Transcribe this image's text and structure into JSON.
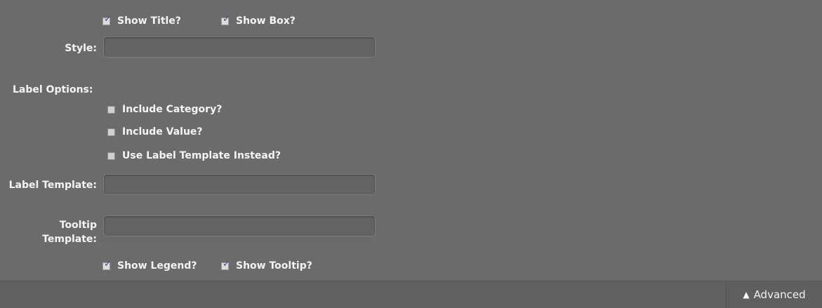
{
  "top_options": [
    {
      "label": "Show Title?",
      "checked": true
    },
    {
      "label": "Show Box?",
      "checked": true
    }
  ],
  "style": {
    "label": "Style:",
    "value": ""
  },
  "label_options": {
    "heading": "Label Options:",
    "items": [
      {
        "label": "Include Category?",
        "checked": false
      },
      {
        "label": "Include Value?",
        "checked": false
      },
      {
        "label": "Use Label Template Instead?",
        "checked": false
      }
    ]
  },
  "label_template": {
    "label": "Label Template:",
    "value": ""
  },
  "tooltip_template": {
    "label_line1": "Tooltip",
    "label_line2": "Template:",
    "value": ""
  },
  "bottom_options": [
    {
      "label": "Show Legend?",
      "checked": true
    },
    {
      "label": "Show Tooltip?",
      "checked": true
    }
  ],
  "footer": {
    "advanced_label": "Advanced",
    "advanced_icon": "chevron-up-icon"
  }
}
